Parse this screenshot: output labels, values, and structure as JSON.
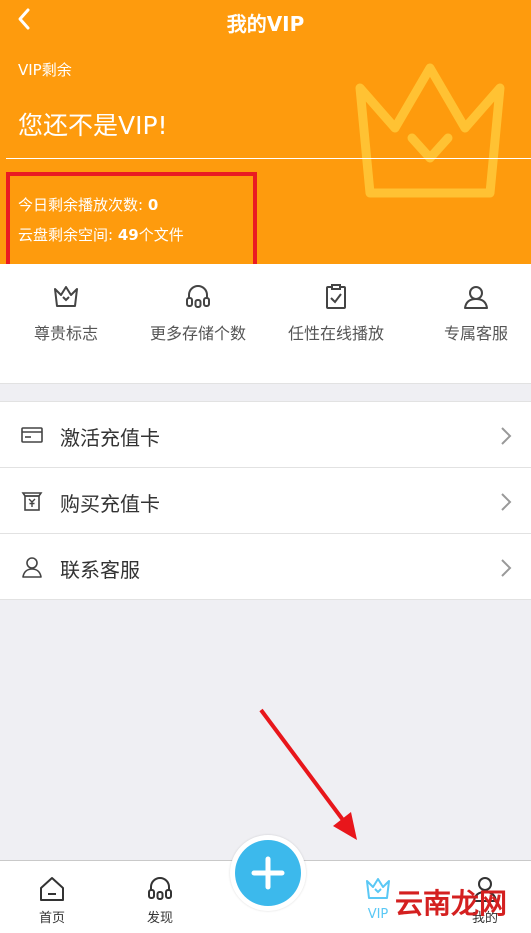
{
  "header": {
    "title": "我的VIP",
    "vip_remaining_label": "VIP剩余",
    "status_text": "您还不是VIP!",
    "plays_label": "今日剩余播放次数:",
    "plays_value": "0",
    "storage_label": "云盘剩余空间:",
    "storage_value": "49",
    "storage_unit": "个文件"
  },
  "features": [
    {
      "label": "尊贵标志",
      "icon": "crown-icon"
    },
    {
      "label": "更多存储个数",
      "icon": "headphones-icon"
    },
    {
      "label": "任性在线播放",
      "icon": "clipboard-check-icon"
    },
    {
      "label": "专属客服",
      "icon": "user-icon"
    }
  ],
  "menu": [
    {
      "label": "激活充值卡",
      "icon": "card-icon"
    },
    {
      "label": "购买充值卡",
      "icon": "yen-box-icon"
    },
    {
      "label": "联系客服",
      "icon": "user-icon"
    }
  ],
  "tabs": [
    {
      "label": "首页",
      "icon": "home-icon"
    },
    {
      "label": "发现",
      "icon": "headphones-icon"
    },
    {
      "label": "VIP",
      "icon": "crown-icon",
      "active": true
    },
    {
      "label": "我的",
      "icon": "user-icon"
    }
  ],
  "watermark": "云南龙网",
  "colors": {
    "accent": "#fe9b0d",
    "highlight_box": "#ea1b22",
    "tab_active": "#5ac8f5",
    "fab": "#3cb9ec"
  }
}
